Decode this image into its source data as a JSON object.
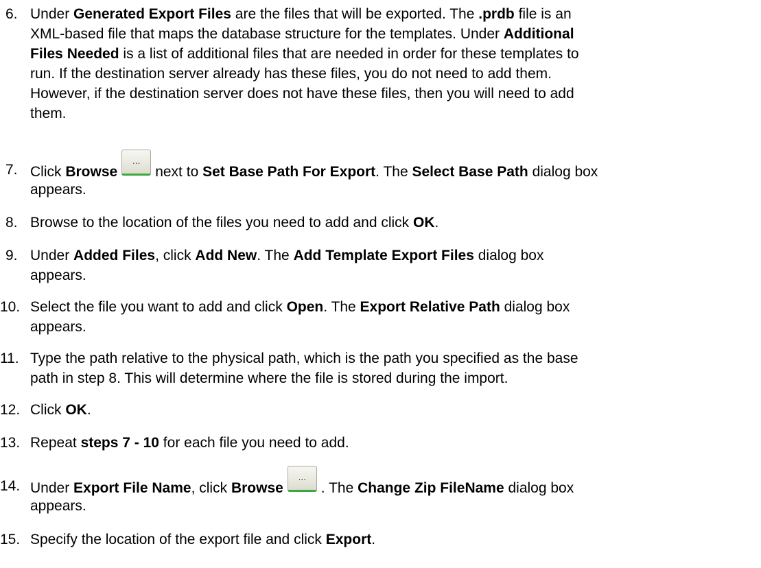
{
  "steps": [
    {
      "number": "6.",
      "lines": [
        [
          [
            "Under ",
            false
          ],
          [
            "Generated Export Files",
            true
          ],
          [
            " are the files that will be exported. The ",
            false
          ],
          [
            ".prdb",
            true
          ],
          [
            " file is an",
            false
          ]
        ],
        [
          [
            "XML-based file that maps the database structure for the templates. Under ",
            false
          ],
          [
            "Additional",
            true
          ]
        ],
        [
          [
            "Files Needed",
            true
          ],
          [
            " is a list of additional files that are needed in order for these templates to",
            false
          ]
        ],
        [
          [
            "run. If the destination server already has these files, you do not need to add them.",
            false
          ]
        ],
        [
          [
            "However, if the destination server does not have these files, then you will need to add",
            false
          ]
        ],
        [
          [
            "them.",
            false
          ]
        ]
      ]
    },
    {
      "number": "7.",
      "lines": [
        [
          [
            "Click ",
            false
          ],
          [
            "Browse",
            true
          ],
          [
            "@button",
            false
          ],
          [
            "next to ",
            false
          ],
          [
            "Set Base Path For Export",
            true
          ],
          [
            ". The ",
            false
          ],
          [
            "Select Base Path",
            true
          ],
          [
            " dialog box",
            false
          ]
        ],
        [
          [
            "appears.",
            false
          ]
        ]
      ]
    },
    {
      "number": "8.",
      "lines": [
        [
          [
            "Browse to the location of the files you need to add and click ",
            false
          ],
          [
            "OK",
            true
          ],
          [
            ".",
            false
          ]
        ]
      ]
    },
    {
      "number": "9.",
      "lines": [
        [
          [
            "Under ",
            false
          ],
          [
            "Added Files",
            true
          ],
          [
            ", click ",
            false
          ],
          [
            "Add New",
            true
          ],
          [
            ". The ",
            false
          ],
          [
            "Add Template Export Files",
            true
          ],
          [
            " dialog box",
            false
          ]
        ],
        [
          [
            "appears.",
            false
          ]
        ]
      ]
    },
    {
      "number": "10.",
      "lines": [
        [
          [
            "Select the file you want to add and click ",
            false
          ],
          [
            "Open",
            true
          ],
          [
            ". The ",
            false
          ],
          [
            "Export Relative Path",
            true
          ],
          [
            " dialog box",
            false
          ]
        ],
        [
          [
            "appears.",
            false
          ]
        ]
      ]
    },
    {
      "number": "11.",
      "lines": [
        [
          [
            "Type the path relative to the physical path, which is the path you specified as the base",
            false
          ]
        ],
        [
          [
            "path in step 8. This will determine where the file is stored during the import.",
            false
          ]
        ]
      ]
    },
    {
      "number": "12.",
      "lines": [
        [
          [
            "Click ",
            false
          ],
          [
            "OK",
            true
          ],
          [
            ".",
            false
          ]
        ]
      ]
    },
    {
      "number": "13.",
      "lines": [
        [
          [
            "Repeat ",
            false
          ],
          [
            "steps 7 - 10",
            true
          ],
          [
            " for each file you need to add.",
            false
          ]
        ]
      ]
    },
    {
      "number": "14.",
      "lines": [
        [
          [
            "Under ",
            false
          ],
          [
            "Export File Name",
            true
          ],
          [
            ", click ",
            false
          ],
          [
            "Browse",
            true
          ],
          [
            "@button",
            false
          ],
          [
            ". The ",
            false
          ],
          [
            "Change Zip FileName",
            true
          ],
          [
            " dialog box",
            false
          ]
        ],
        [
          [
            "appears.",
            false
          ]
        ]
      ]
    },
    {
      "number": "15.",
      "lines": [
        [
          [
            "Specify the location of the export file and click ",
            false
          ],
          [
            "Export",
            true
          ],
          [
            ".",
            false
          ]
        ]
      ]
    }
  ],
  "browse_button": {
    "label": "...",
    "icon": "ellipsis-button-icon"
  }
}
